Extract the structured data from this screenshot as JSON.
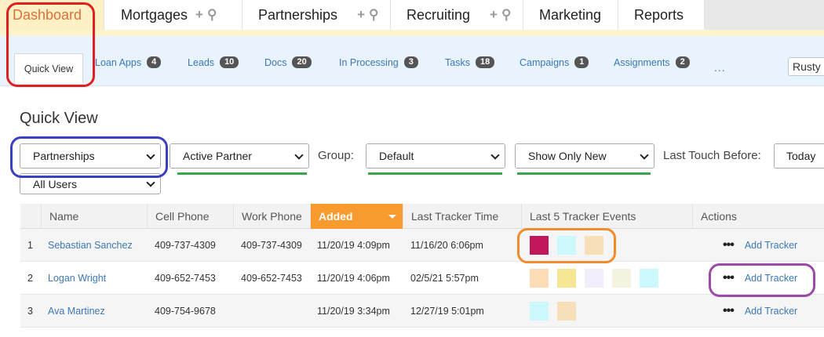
{
  "top_tabs": [
    {
      "label": "Dashboard"
    },
    {
      "label": "Mortgages",
      "icons": [
        "plus-icon",
        "search-icon"
      ]
    },
    {
      "label": "Partnerships",
      "icons": [
        "plus-icon",
        "search-icon"
      ]
    },
    {
      "label": "Recruiting",
      "icons": [
        "plus-icon",
        "search-icon"
      ]
    },
    {
      "label": "Marketing"
    },
    {
      "label": "Reports"
    }
  ],
  "icons": {
    "plus": "+",
    "search": "⚲",
    "more": "..."
  },
  "sub_tabs": [
    {
      "label": "Quick View"
    },
    {
      "label": "Loan Apps",
      "count": "4"
    },
    {
      "label": "Leads",
      "count": "10"
    },
    {
      "label": "Docs",
      "count": "20"
    },
    {
      "label": "In Processing",
      "count": "3"
    },
    {
      "label": "Tasks",
      "count": "18"
    },
    {
      "label": "Campaigns",
      "count": "1"
    },
    {
      "label": "Assignments",
      "count": "2"
    }
  ],
  "user_button": "Rusty",
  "page_title": "Quick View",
  "filters": {
    "type_select": "Partnerships",
    "status_select": "Active Partner",
    "group_label": "Group:",
    "group_select": "Default",
    "new_select": "Show Only New",
    "last_touch_label": "Last Touch Before:",
    "last_touch_value": "Today",
    "users_select": "All Users"
  },
  "table": {
    "columns": [
      "",
      "Name",
      "Cell Phone",
      "Work Phone",
      "Added",
      "Last Tracker Time",
      "Last 5 Tracker Events",
      "Actions"
    ],
    "rows": [
      {
        "num": "1",
        "name": "Sebastian Sanchez",
        "cell": "409-737-4309",
        "work": "409-737-4309",
        "added": "11/20/19 4:09pm",
        "last_tracker": "11/16/20 6:06pm",
        "events": [
          "#c2185b",
          "#ccf7fb",
          "#f7dfb8"
        ],
        "action": "Add Tracker"
      },
      {
        "num": "2",
        "name": "Logan Wright",
        "cell": "409-652-7453",
        "work": "409-652-7453",
        "added": "11/20/19 4:06pm",
        "last_tracker": "02/5/21 5:57pm",
        "events": [
          "#fcdcb4",
          "#f5e693",
          "#f2ecfb",
          "#f4f3df",
          "#ccf7fb"
        ],
        "action": "Add Tracker"
      },
      {
        "num": "3",
        "name": "Ava Martinez",
        "cell": "409-754-9678",
        "work": "",
        "added": "11/20/19 3:34pm",
        "last_tracker": "12/27/19 5:01pm",
        "events": [
          "#ccf7fb",
          "#f7dfb8"
        ],
        "action": "Add Tracker"
      }
    ]
  },
  "colors": {
    "accent_orange": "#f79b2e",
    "link_blue": "#3b78b5",
    "annotation_red": "#e02020",
    "annotation_blue": "#3a3fc2",
    "annotation_orange": "#f28a2e",
    "annotation_purple": "#9b4aa8",
    "underline_green": "#3aa64a"
  }
}
